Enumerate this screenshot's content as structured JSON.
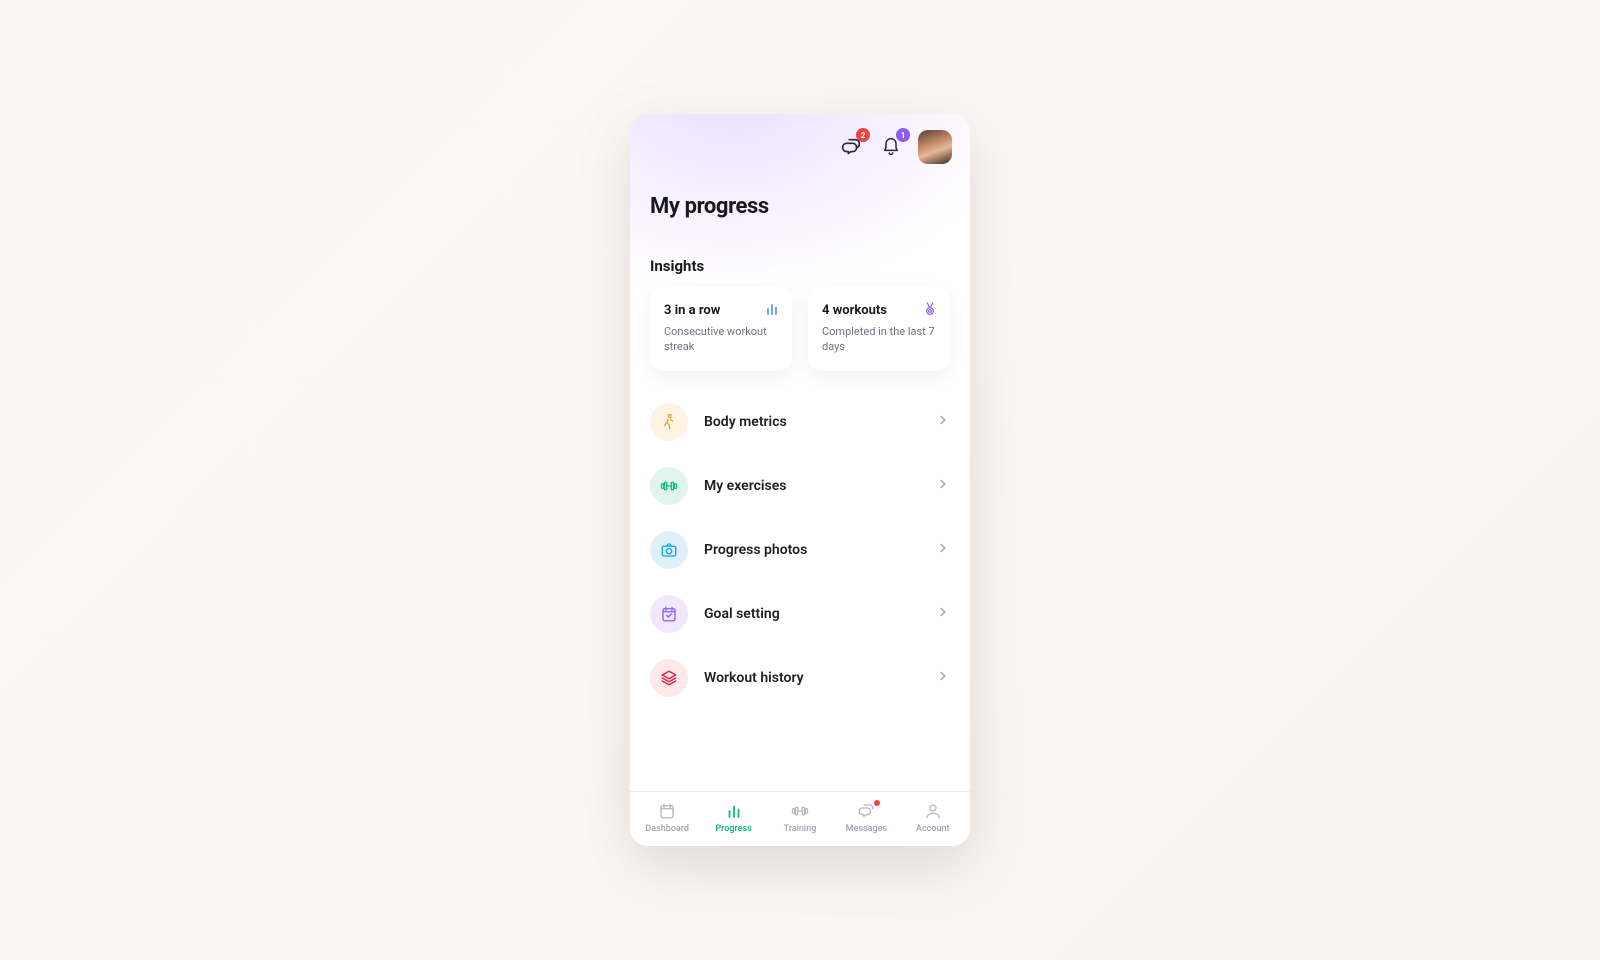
{
  "header": {
    "messages_badge": "2",
    "notifications_badge": "1"
  },
  "page_title": "My progress",
  "insights": {
    "section_title": "Insights",
    "cards": [
      {
        "title": "3 in a row",
        "subtitle": "Consecutive workout streak"
      },
      {
        "title": "4 workouts",
        "subtitle": "Completed in the last 7 days"
      }
    ]
  },
  "menu": [
    {
      "label": "Body metrics"
    },
    {
      "label": "My exercises"
    },
    {
      "label": "Progress photos"
    },
    {
      "label": "Goal setting"
    },
    {
      "label": "Workout history"
    }
  ],
  "bottomnav": [
    {
      "label": "Dashboard"
    },
    {
      "label": "Progress"
    },
    {
      "label": "Training"
    },
    {
      "label": "Messages"
    },
    {
      "label": "Account"
    }
  ]
}
